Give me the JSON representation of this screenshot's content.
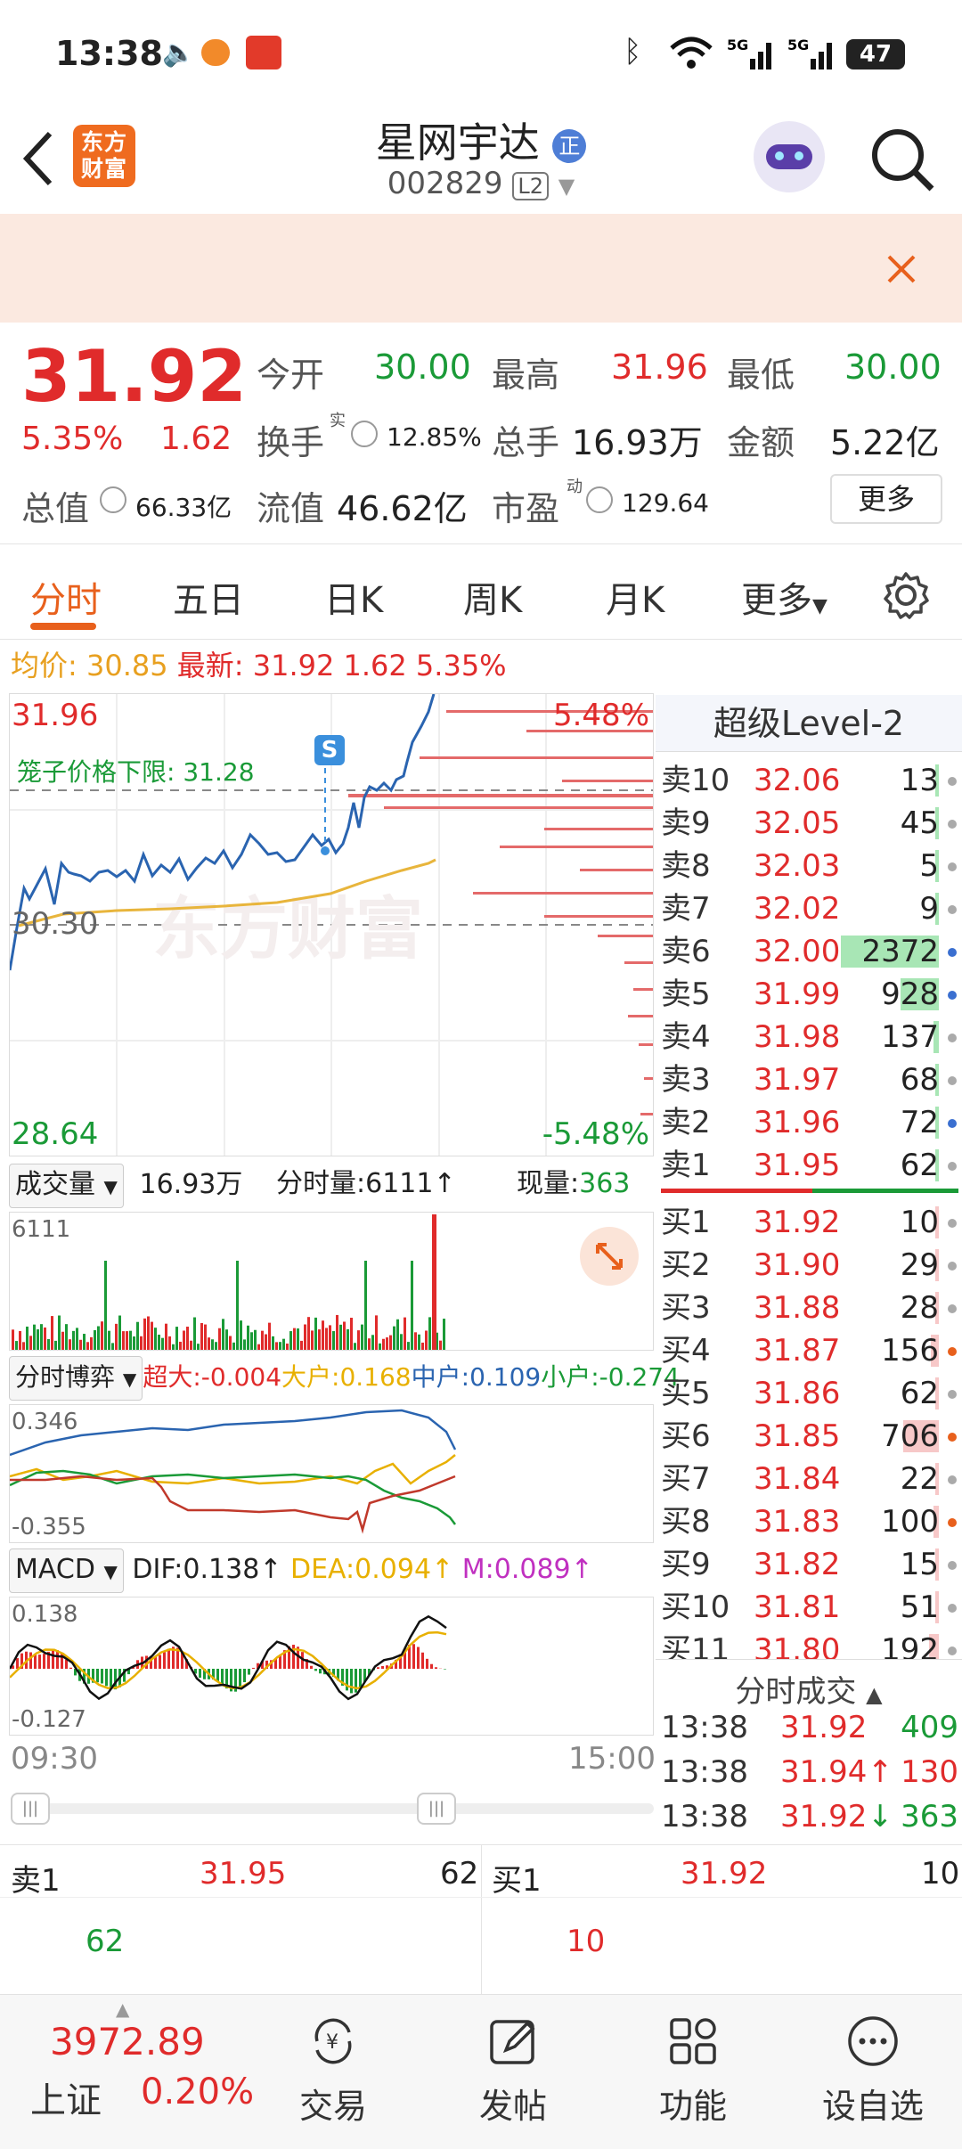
{
  "status_bar": {
    "time": "13:38",
    "battery": "47"
  },
  "header": {
    "logo_text": "东方财富",
    "stock_name": "星网宇达",
    "badge": "正",
    "code": "002829",
    "level": "L2"
  },
  "quote": {
    "price": "31.92",
    "change_pct": "5.35%",
    "change": "1.62",
    "open_label": "今开",
    "open": "30.00",
    "high_label": "最高",
    "high": "31.96",
    "low_label": "最低",
    "low": "30.00",
    "turnover_label": "换手",
    "turnover_sup": "实",
    "turnover": "12.85%",
    "volume_label": "总手",
    "volume": "16.93万",
    "amount_label": "金额",
    "amount": "5.22亿",
    "mcap_label": "总值",
    "mcap": "66.33亿",
    "float_label": "流值",
    "float": "46.62亿",
    "pe_label": "市盈",
    "pe_sup": "动",
    "pe": "129.64",
    "more_button": "更多"
  },
  "tabs": [
    {
      "label": "分时"
    },
    {
      "label": "五日"
    },
    {
      "label": "日K"
    },
    {
      "label": "周K"
    },
    {
      "label": "月K"
    },
    {
      "label": "更多"
    }
  ],
  "intraday": {
    "avg_label": "均价:",
    "avg": "30.85",
    "latest_label": "最新:",
    "latest": "31.92",
    "latest_change": "1.62",
    "latest_pct": "5.35%",
    "y_top": "31.96",
    "y_mid": "30.30",
    "y_bottom": "28.64",
    "pct_top": "5.48%",
    "pct_bottom": "-5.48%",
    "cage_label": "笼子价格下限:",
    "cage_value": "31.28",
    "marker": "S",
    "watermark": "东方财富"
  },
  "volume_panel": {
    "selector": "成交量",
    "total": "16.93万",
    "tick_label": "分时量:",
    "tick_value": "6111",
    "current_label": "现量:",
    "current_value": "363",
    "axis_max": "6111"
  },
  "flow_panel": {
    "selector": "分时博弈",
    "super_label": "超大:",
    "super": "-0.004",
    "large_label": "大户:",
    "large": "0.168",
    "mid_label": "中户:",
    "mid": "0.109",
    "small_label": "小户:",
    "small": "-0.274",
    "axis_max": "0.346",
    "axis_min": "-0.355"
  },
  "macd_panel": {
    "selector": "MACD",
    "dif_label": "DIF:",
    "dif": "0.138",
    "dea_label": "DEA:",
    "dea": "0.094",
    "m_label": "M:",
    "m": "0.089",
    "axis_max": "0.138",
    "axis_min": "-0.127"
  },
  "time_axis": {
    "start": "09:30",
    "end": "15:00"
  },
  "order_book": {
    "title": "超级Level-2",
    "asks": [
      {
        "label": "卖10",
        "price": "32.06",
        "vol": "13"
      },
      {
        "label": "卖9",
        "price": "32.05",
        "vol": "45"
      },
      {
        "label": "卖8",
        "price": "32.03",
        "vol": "5"
      },
      {
        "label": "卖7",
        "price": "32.02",
        "vol": "9"
      },
      {
        "label": "卖6",
        "price": "32.00",
        "vol": "2372"
      },
      {
        "label": "卖5",
        "price": "31.99",
        "vol": "928"
      },
      {
        "label": "卖4",
        "price": "31.98",
        "vol": "137"
      },
      {
        "label": "卖3",
        "price": "31.97",
        "vol": "68"
      },
      {
        "label": "卖2",
        "price": "31.96",
        "vol": "72"
      },
      {
        "label": "卖1",
        "price": "31.95",
        "vol": "62"
      }
    ],
    "bids": [
      {
        "label": "买1",
        "price": "31.92",
        "vol": "10"
      },
      {
        "label": "买2",
        "price": "31.90",
        "vol": "29"
      },
      {
        "label": "买3",
        "price": "31.88",
        "vol": "28"
      },
      {
        "label": "买4",
        "price": "31.87",
        "vol": "156"
      },
      {
        "label": "买5",
        "price": "31.86",
        "vol": "62"
      },
      {
        "label": "买6",
        "price": "31.85",
        "vol": "706"
      },
      {
        "label": "买7",
        "price": "31.84",
        "vol": "22"
      },
      {
        "label": "买8",
        "price": "31.83",
        "vol": "100"
      },
      {
        "label": "买9",
        "price": "31.82",
        "vol": "15"
      },
      {
        "label": "买10",
        "price": "31.81",
        "vol": "51"
      },
      {
        "label": "买11",
        "price": "31.80",
        "vol": "192"
      }
    ],
    "trades_title": "分时成交",
    "trades": [
      {
        "time": "13:38",
        "price": "31.92",
        "arrow": "",
        "vol": "409"
      },
      {
        "time": "13:38",
        "price": "31.94",
        "arrow": "↑",
        "vol": "130"
      },
      {
        "time": "13:38",
        "price": "31.92",
        "arrow": "↓",
        "vol": "363"
      }
    ]
  },
  "bottom_book": {
    "ask_label": "卖1",
    "ask_price": "31.95",
    "ask_vol": "62",
    "ask_sub": "62",
    "bid_label": "买1",
    "bid_price": "31.92",
    "bid_vol": "10",
    "bid_sub": "10"
  },
  "footer": {
    "index_value": "3972.89",
    "index_name": "上证",
    "index_pct": "0.20%",
    "buttons": [
      {
        "label": "交易",
        "icon": "yen-exchange-icon"
      },
      {
        "label": "发帖",
        "icon": "edit-post-icon"
      },
      {
        "label": "功能",
        "icon": "grid-function-icon"
      },
      {
        "label": "设自选",
        "icon": "more-dots-icon"
      }
    ]
  },
  "colors": {
    "up": "#e02b2b",
    "down": "#1a9a37",
    "accent": "#e8601c",
    "price_line": "#2a64b0",
    "avg_line": "#e8b53c",
    "banner_bg": "#fbe9e0"
  }
}
